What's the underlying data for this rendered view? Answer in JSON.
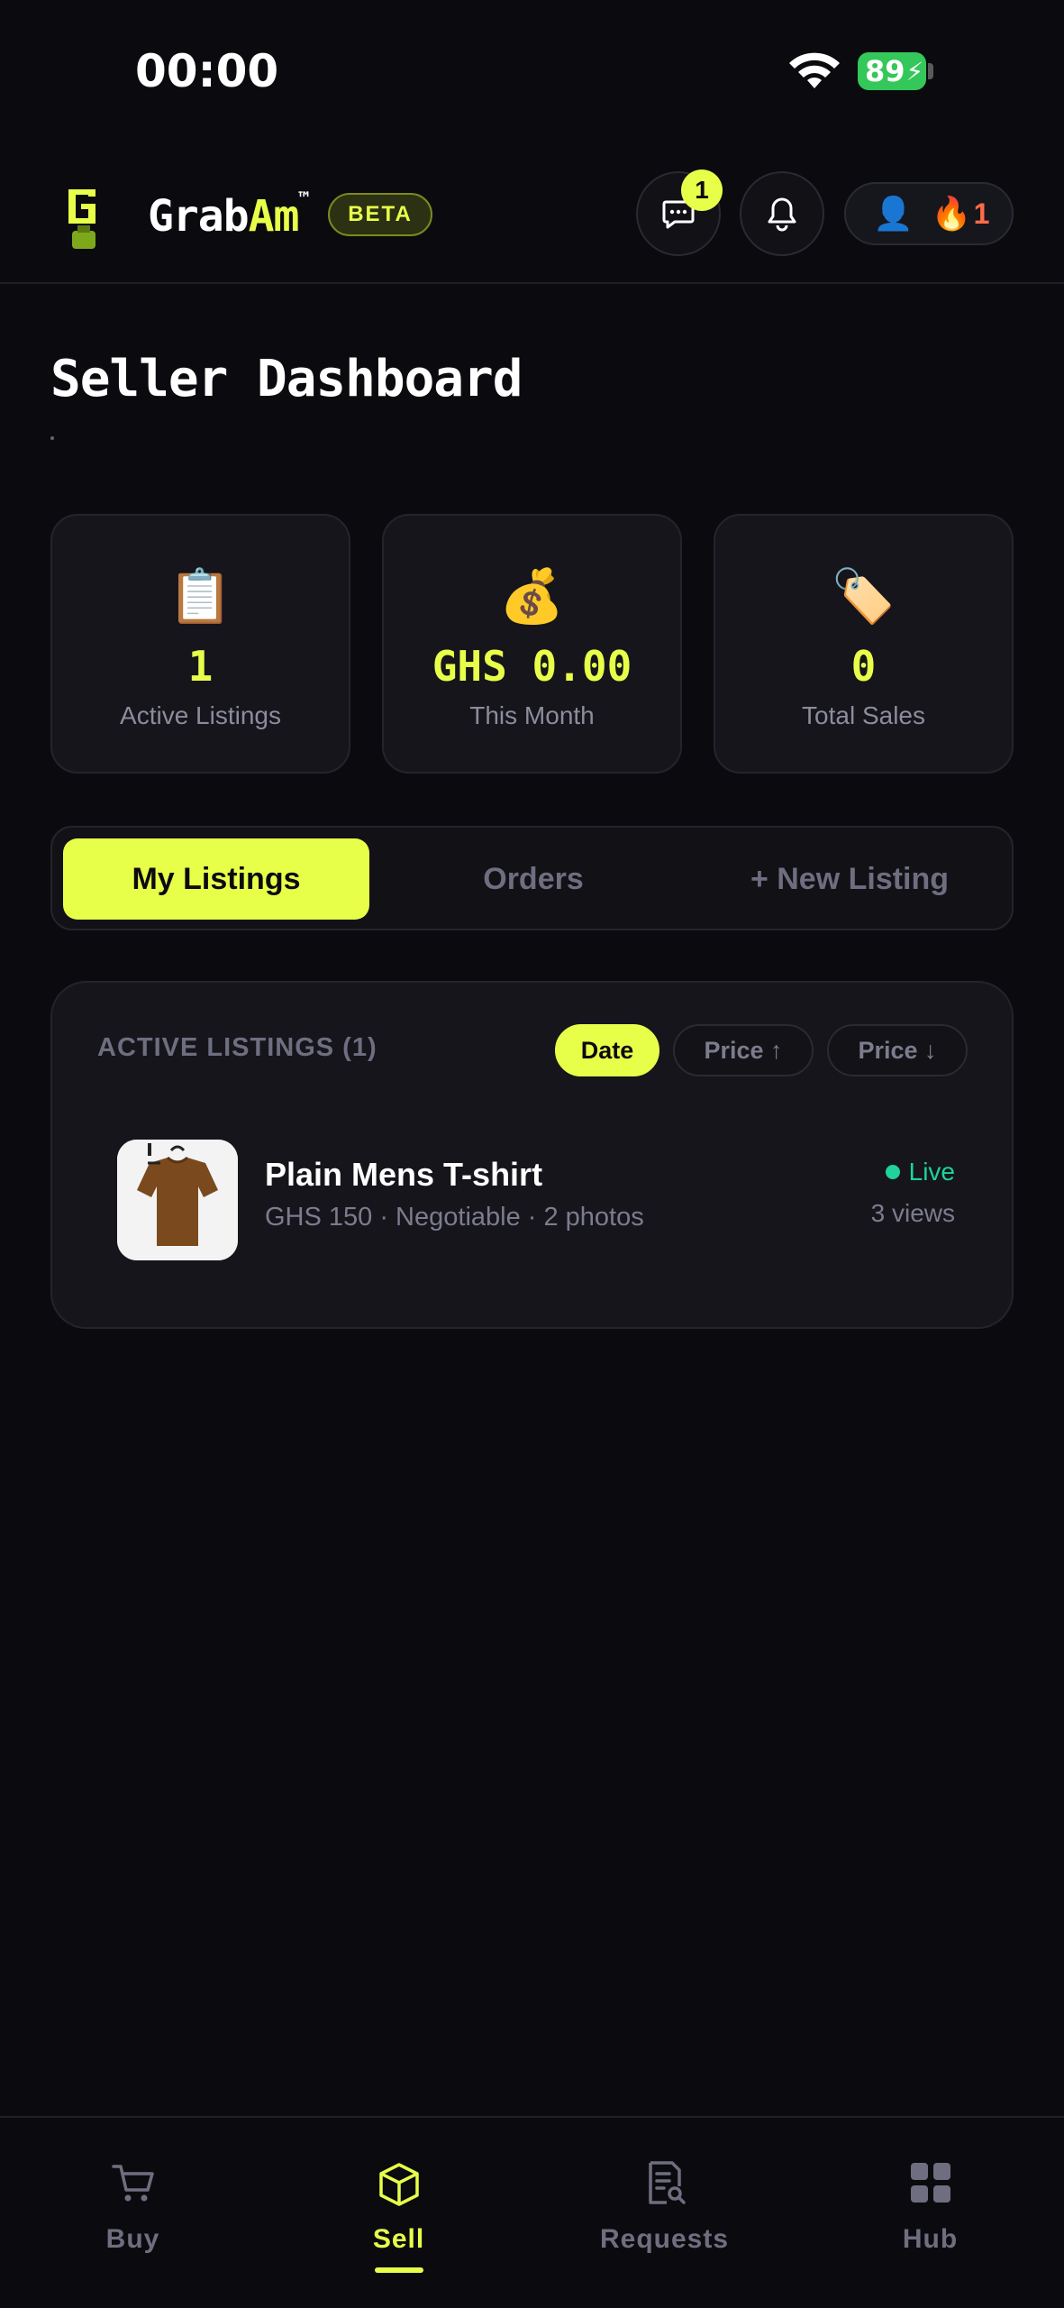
{
  "status_bar": {
    "time": "00:00",
    "battery": "89"
  },
  "header": {
    "brand_prefix": "Grab",
    "brand_accent": "Am",
    "brand_tm": "™",
    "badge": "BETA",
    "messages_count": "1",
    "streak_count": "1",
    "accent_color": "#e8ff4a"
  },
  "page": {
    "title": "Seller Dashboard"
  },
  "stats": [
    {
      "icon": "clipboard",
      "emoji": "📋",
      "value": "1",
      "label": "Active Listings"
    },
    {
      "icon": "money-bag",
      "emoji": "💰",
      "value": "GHS 0.00",
      "label": "This Month"
    },
    {
      "icon": "tag",
      "emoji": "🏷️",
      "value": "0",
      "label": "Total Sales"
    }
  ],
  "tabs": [
    {
      "label": "My Listings",
      "active": true
    },
    {
      "label": "Orders",
      "active": false
    },
    {
      "label": "+ New Listing",
      "active": false
    }
  ],
  "listings": {
    "title": "ACTIVE LISTINGS (1)",
    "sort_options": [
      "Date",
      "Price ↑",
      "Price ↓"
    ],
    "selected_sort": "Date",
    "items": [
      {
        "name": "Plain Mens T-shirt",
        "meta": "GHS 150 · Negotiable · 2 photos",
        "status": "Live",
        "views": "3 views"
      }
    ]
  },
  "bottom_nav": [
    {
      "label": "Buy",
      "icon": "cart-icon",
      "active": false
    },
    {
      "label": "Sell",
      "icon": "box-icon",
      "active": true
    },
    {
      "label": "Requests",
      "icon": "document-search-icon",
      "active": false
    },
    {
      "label": "Hub",
      "icon": "grid-icon",
      "active": false
    }
  ]
}
